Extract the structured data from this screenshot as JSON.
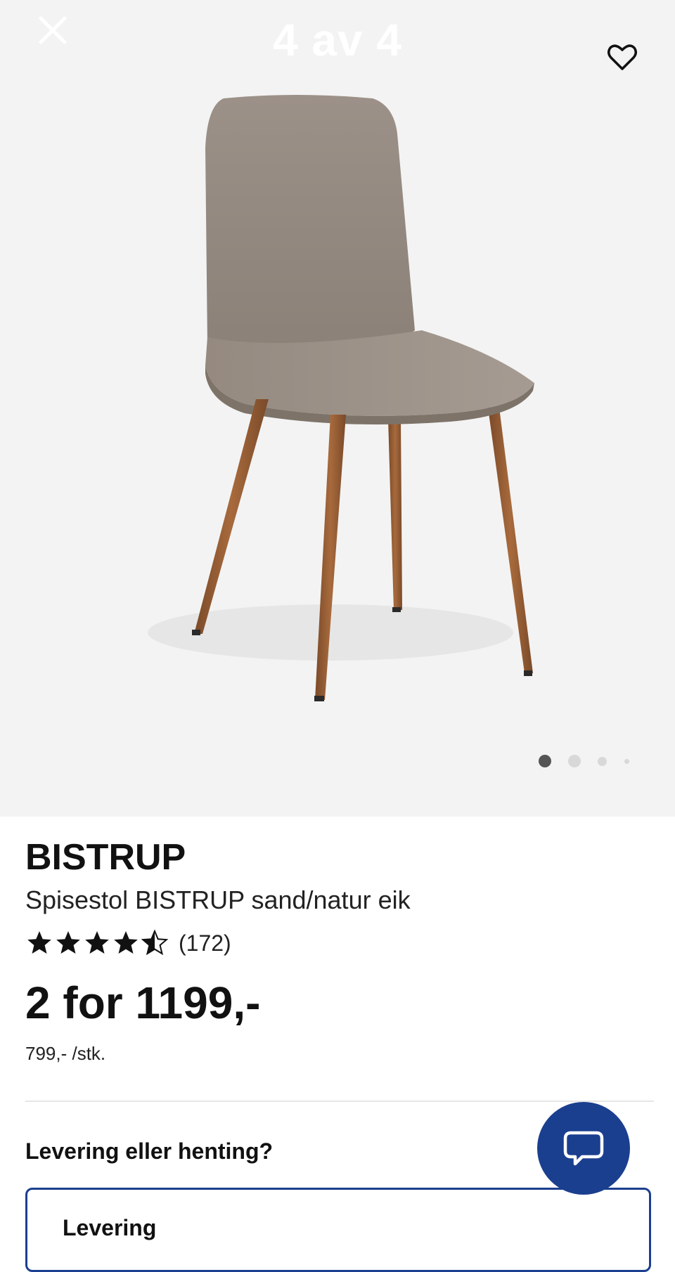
{
  "gallery": {
    "counter": "4 av 4",
    "close_icon": "close-icon",
    "favorite_icon": "heart-icon",
    "image_alt": "chair-photo",
    "dots_total": 4,
    "dots_active_index": 0
  },
  "product": {
    "brand": "BISTRUP",
    "description": "Spisestol BISTRUP sand/natur eik",
    "rating_stars": 4.5,
    "rating_max": 5,
    "review_count": "(172)",
    "price": "2 for 1199,-",
    "unit_price": "799,- /stk."
  },
  "delivery": {
    "question": "Levering eller henting?",
    "option_label": "Levering"
  },
  "chat": {
    "icon": "chat-bubble-icon"
  },
  "colors": {
    "accent": "#1b3f8f",
    "gallery_bg": "#f3f3f3"
  }
}
